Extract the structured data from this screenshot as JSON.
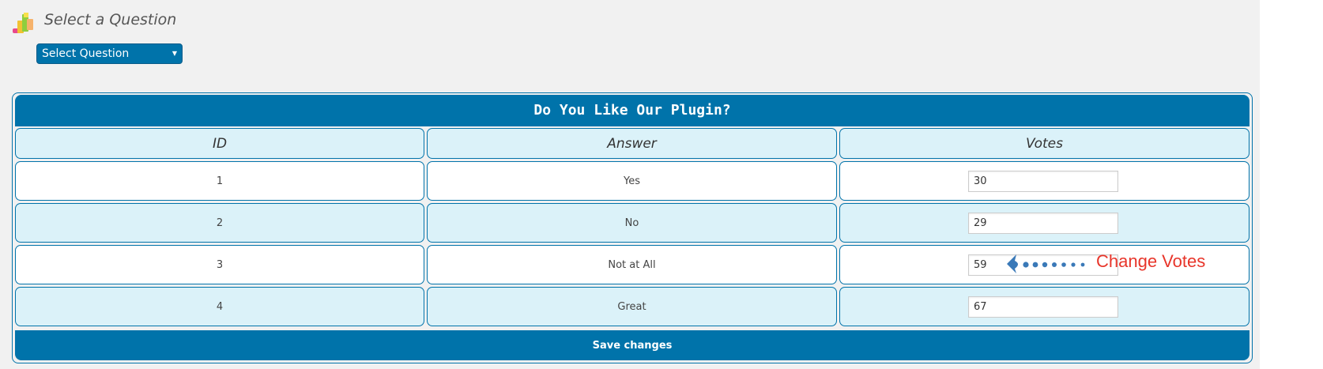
{
  "header": {
    "title": "Select a Question",
    "logo_icon": "bar-chart-icon"
  },
  "question_select": {
    "selected": "Select Question",
    "arrow_icon": "triangle-down-icon"
  },
  "poll": {
    "title": "Do You Like Our Plugin?",
    "columns": [
      "ID",
      "Answer",
      "Votes"
    ],
    "rows": [
      {
        "id": "1",
        "answer": "Yes",
        "votes": "30"
      },
      {
        "id": "2",
        "answer": "No",
        "votes": "29"
      },
      {
        "id": "3",
        "answer": "Not at All",
        "votes": "59"
      },
      {
        "id": "4",
        "answer": "Great",
        "votes": "67"
      }
    ],
    "save_label": "Save changes"
  },
  "annotation": {
    "text": "Change Votes",
    "arrow_icon": "dotted-arrow-left-icon"
  },
  "colors": {
    "accent": "#0073aa",
    "row_alt": "#dbf2f9",
    "background": "#f1f1f1",
    "annotation": "#e8352a"
  }
}
